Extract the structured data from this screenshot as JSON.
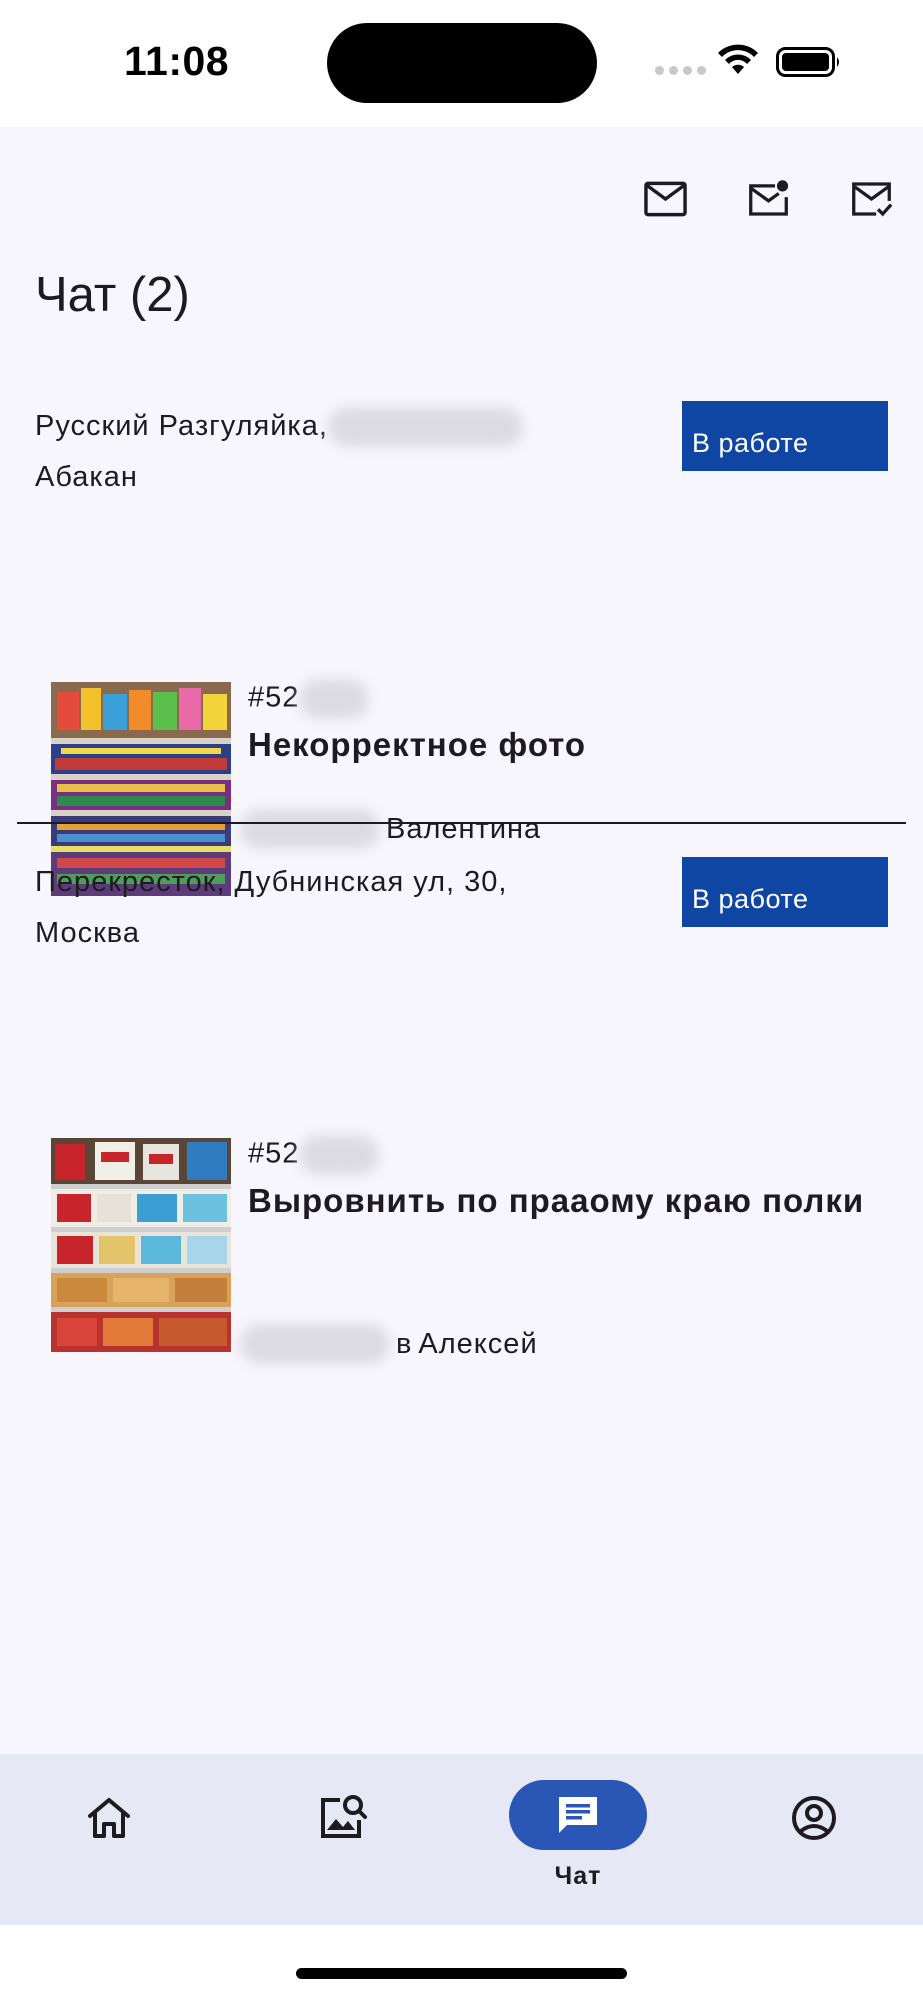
{
  "status_bar": {
    "time": "11:08"
  },
  "header": {
    "title": "Чат (2)",
    "actions": [
      "mail-icon",
      "mail-unread-icon",
      "mail-read-icon"
    ]
  },
  "chats": [
    {
      "store_prefix": "Русский Разгуляйка,",
      "store_city": "Абакан",
      "status": "В работе",
      "ticket_id": "#52",
      "title": "Некорректное фото",
      "assignee": "Валентина"
    },
    {
      "store_prefix": "Перекресток, Дубнинская ул, 30,",
      "store_city": "Москва",
      "status": "В работе",
      "ticket_id": "#52",
      "title": "Выровнить по праaому краю полки",
      "assignee_suffix": "в",
      "assignee": "Алексей"
    }
  ],
  "bottom_nav": {
    "items": [
      {
        "icon": "home-icon"
      },
      {
        "icon": "image-search-icon"
      },
      {
        "icon": "chat-icon",
        "label": "Чат",
        "active": true
      },
      {
        "icon": "account-circle-icon"
      }
    ]
  },
  "colors": {
    "accent": "#0f46a3",
    "nav_active": "#2a56b5",
    "background": "#f7f6fc",
    "nav_background": "#e6e8f6"
  }
}
